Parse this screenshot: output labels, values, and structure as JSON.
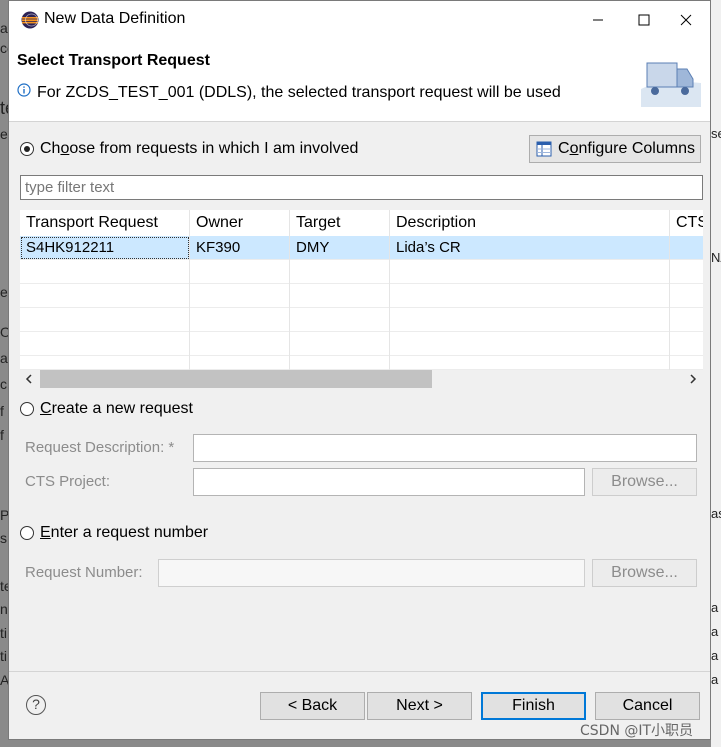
{
  "window": {
    "title": "New Data Definition",
    "minimize": "─",
    "maximize": "☐",
    "close": "✕"
  },
  "header": {
    "title": "Select Transport Request",
    "message": "For ZCDS_TEST_001 (DDLS), the selected transport request will be used"
  },
  "choose": {
    "label_pre": "Ch",
    "label_u": "o",
    "label_post": "ose from requests in which I am involved",
    "selected": true
  },
  "configure": {
    "label_pre": "C",
    "label_u": "o",
    "label_post": "nfigure Columns"
  },
  "filter": {
    "placeholder": "type filter text"
  },
  "table": {
    "columns": [
      "Transport Request",
      "Owner",
      "Target",
      "Description",
      "CTS"
    ],
    "rows": [
      {
        "request": "S4HK912211",
        "owner": "KF390",
        "target": "DMY",
        "description": "Lida’s  CR",
        "cts": "",
        "selected": true
      }
    ],
    "scroll_left": "‹",
    "scroll_right": "›"
  },
  "create": {
    "label_u": "C",
    "label_post": "reate a new request",
    "desc_label": "Request Description: *",
    "cts_label": "CTS Project:",
    "browse": "Browse..."
  },
  "enter": {
    "label_u": "E",
    "label_post": "nter a request number",
    "num_label": "Request Number:",
    "browse": "Browse..."
  },
  "buttons": {
    "back": "< Back",
    "next": "Next >",
    "finish": "Finish",
    "cancel": "Cancel",
    "help": "?"
  },
  "watermark": "CSDN @IT小职员",
  "background": {
    "left": [
      "a",
      "ce",
      "te",
      "ev",
      "e",
      "O",
      "ac",
      "c",
      "f",
      "f",
      "P",
      "s,",
      "te",
      "n",
      "ti",
      "ti",
      "A"
    ],
    "right": [
      "se",
      "NA",
      "as",
      "a",
      "a",
      "a",
      "a"
    ]
  }
}
